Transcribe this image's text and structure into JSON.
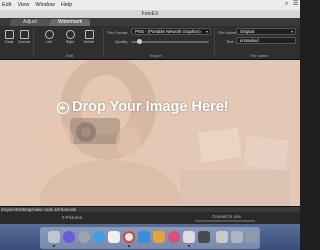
{
  "menubar": {
    "items": [
      "Edit",
      "View",
      "Window",
      "Help"
    ]
  },
  "window": {
    "title": "FotoEX"
  },
  "tabs": [
    {
      "label": "Adjust",
      "selected": false
    },
    {
      "label": "Watermark",
      "selected": true
    }
  ],
  "toolbar": {
    "buttons": [
      {
        "label": "Tools",
        "icon": "tools-icon"
      },
      {
        "label": "Convert",
        "icon": "convert-icon"
      },
      {
        "label": "Left",
        "icon": "rotate-left-icon"
      },
      {
        "label": "Right",
        "icon": "rotate-right-icon"
      },
      {
        "label": "Delete",
        "icon": "delete-icon"
      }
    ],
    "edit_group_label": "Edit",
    "export": {
      "file_format_label": "File Format:",
      "file_format_value": "PNG - (Portable Network Graphics)",
      "quality_label": "Quality:",
      "group_label": "Export"
    },
    "file_name": {
      "label": "File Name:",
      "value": "Original",
      "text_label": "Text:",
      "text_value": "unmarked",
      "group_label": "File name"
    }
  },
  "drop_area": {
    "text": "Drop Your Image Here!"
  },
  "path_bar": {
    "text": "irs/jai/AIDesktop/make code 1/8 barcode"
  },
  "status": {
    "count": "0 Pictures",
    "status_text": "Convert is one"
  },
  "colors": {
    "accent": "#3b4d7a",
    "drop_overlay": "#d9b8a3"
  }
}
